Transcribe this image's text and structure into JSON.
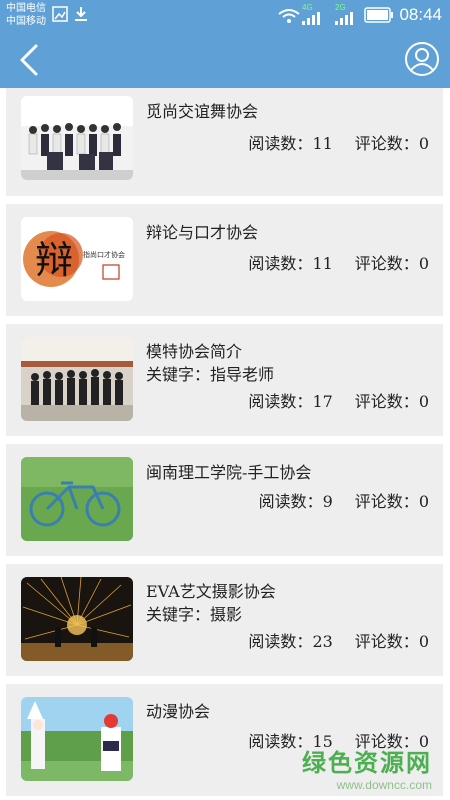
{
  "status_bar": {
    "carrier_1": "中国电信",
    "carrier_2": "中国移动",
    "net_1": "4G",
    "net_2": "2G",
    "time": "08:44",
    "icons": [
      "gallery-icon",
      "download-icon",
      "wifi-icon",
      "signal-icon",
      "battery-icon"
    ]
  },
  "header": {
    "back_icon": "back-chevron-icon",
    "user_icon": "user-profile-icon",
    "background": "#5fa1d6"
  },
  "list": {
    "items": [
      {
        "title": "觅尚交谊舞协会",
        "keyword": "",
        "read_label": "阅读数：",
        "reads": "11",
        "comment_label": "评论数：",
        "comments": "0"
      },
      {
        "title": "辩论与口才协会",
        "keyword": "",
        "read_label": "阅读数：",
        "reads": "11",
        "comment_label": "评论数：",
        "comments": "0"
      },
      {
        "title": "模特协会简介",
        "keyword": "关键字：指导老师",
        "read_label": "阅读数：",
        "reads": "17",
        "comment_label": "评论数：",
        "comments": "0"
      },
      {
        "title": "闽南理工学院-手工协会",
        "keyword": "",
        "read_label": "阅读数：",
        "reads": "9",
        "comment_label": "评论数：",
        "comments": "0"
      },
      {
        "title": "EVA艺文摄影协会",
        "keyword": "关键字：摄影",
        "read_label": "阅读数：",
        "reads": "23",
        "comment_label": "评论数：",
        "comments": "0"
      },
      {
        "title": "动漫协会",
        "keyword": "",
        "read_label": "阅读数：",
        "reads": "15",
        "comment_label": "评论数：",
        "comments": "0"
      }
    ]
  },
  "watermark": {
    "title": "绿色资源网",
    "url": "www.downcc.com"
  }
}
